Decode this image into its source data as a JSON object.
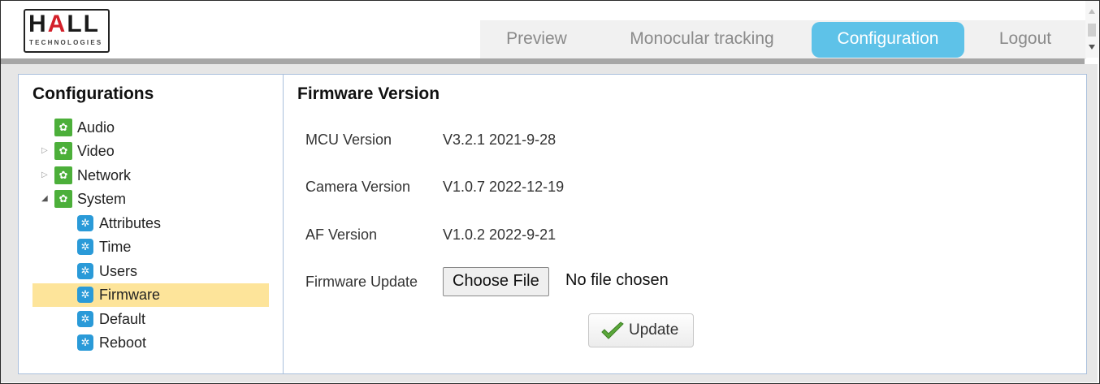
{
  "brand": {
    "logo_text_a": "H",
    "logo_text_red": "A",
    "logo_text_b": "LL",
    "logo_sub": "TECHNOLOGIES"
  },
  "nav": {
    "preview": "Preview",
    "tracking": "Monocular tracking",
    "configuration": "Configuration",
    "logout": "Logout"
  },
  "sidebar": {
    "title": "Configurations",
    "items": [
      {
        "label": "Audio",
        "icon": "gear-green-icon"
      },
      {
        "label": "Video",
        "icon": "gear-green-icon"
      },
      {
        "label": "Network",
        "icon": "gear-green-icon"
      },
      {
        "label": "System",
        "icon": "gear-green-icon"
      }
    ],
    "system_children": [
      {
        "label": "Attributes",
        "icon": "gear-blue-icon"
      },
      {
        "label": "Time",
        "icon": "gear-blue-icon"
      },
      {
        "label": "Users",
        "icon": "gear-blue-icon"
      },
      {
        "label": "Firmware",
        "icon": "gear-blue-icon"
      },
      {
        "label": "Default",
        "icon": "gear-blue-icon"
      },
      {
        "label": "Reboot",
        "icon": "gear-blue-icon"
      }
    ]
  },
  "main": {
    "title": "Firmware Version",
    "mcu_label": "MCU Version",
    "mcu_value": "V3.2.1 2021-9-28",
    "camera_label": "Camera Version",
    "camera_value": "V1.0.7 2022-12-19",
    "af_label": "AF Version",
    "af_value": "V1.0.2 2022-9-21",
    "update_label": "Firmware Update",
    "choose_file": "Choose File",
    "file_status": "No file chosen",
    "update_button": "Update"
  },
  "colors": {
    "accent": "#5ec2e8",
    "selected": "#fde49a",
    "green_icon": "#4caf3a",
    "blue_icon": "#2a9ad8"
  }
}
